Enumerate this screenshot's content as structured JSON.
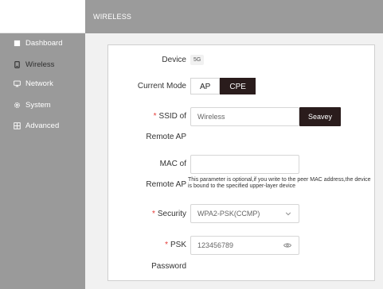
{
  "header": {
    "title": "WIRELESS"
  },
  "sidebar": {
    "items": [
      {
        "label": "Dashboard",
        "icon": "square-icon"
      },
      {
        "label": "Wireless",
        "icon": "tablet-icon",
        "active": true
      },
      {
        "label": "Network",
        "icon": "monitor-icon"
      },
      {
        "label": "System",
        "icon": "gear-icon"
      },
      {
        "label": "Advanced",
        "icon": "grid-icon"
      }
    ]
  },
  "form": {
    "device": {
      "label": "Device",
      "value": "5G"
    },
    "mode": {
      "label": "Current Mode",
      "options": [
        "AP",
        "CPE"
      ],
      "selected": "CPE"
    },
    "ssid": {
      "label_line1": "SSID of",
      "label_line2": "Remote AP",
      "value": "Wireless",
      "scan_label": "Seavey"
    },
    "mac": {
      "label_line1": "MAC of",
      "label_line2": "Remote AP",
      "value": "",
      "hint": "This parameter is optional,if you write to the peer MAC address,the device is bound to the specified upper-layer device"
    },
    "security": {
      "label": "Security",
      "value": "WPA2-PSK(CCMP)"
    },
    "psk": {
      "label_line1": "PSK",
      "label_line2": "Password",
      "value": "123456789"
    }
  },
  "colors": {
    "sidebar_bg": "#9a9a9a",
    "header_bg": "#9b9b9b",
    "accent_dark": "#2a1c1c",
    "required": "#e53935"
  }
}
